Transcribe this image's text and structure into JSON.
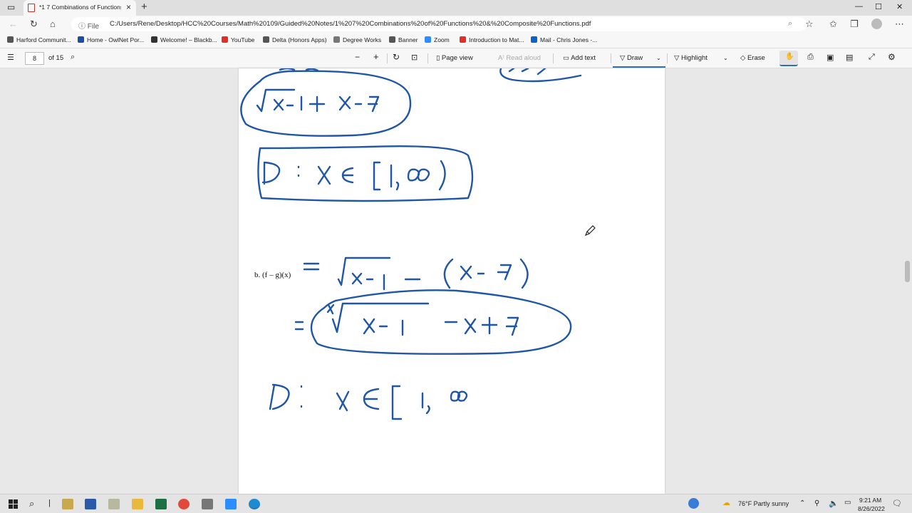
{
  "browser": {
    "tab_title": "*1 7 Combinations of Functions",
    "address_prefix": "File",
    "url": "C:/Users/Rene/Desktop/HCC%20Courses/Math%20109/Guided%20Notes/1%207%20Combinations%20of%20Functions%20&%20Composite%20Functions.pdf",
    "window_controls": {
      "minimize": "—",
      "maximize": "☐",
      "close": "✕"
    }
  },
  "bookmarks": [
    {
      "label": "Harford Communit...",
      "icon": "building-icon",
      "color": "#555555"
    },
    {
      "label": "Home - OwlNet Por...",
      "icon": "owl-icon",
      "color": "#1a4fa0"
    },
    {
      "label": "Welcome! – Blackb...",
      "icon": "blackboard-icon",
      "color": "#333333"
    },
    {
      "label": "YouTube",
      "icon": "youtube-icon",
      "color": "#e52d27"
    },
    {
      "label": "Delta (Honors Apps)",
      "icon": "building-icon",
      "color": "#555555"
    },
    {
      "label": "Degree Works",
      "icon": "document-icon",
      "color": "#777777"
    },
    {
      "label": "Banner",
      "icon": "building-icon",
      "color": "#555555"
    },
    {
      "label": "Zoom",
      "icon": "zoom-icon",
      "color": "#2d8cff"
    },
    {
      "label": "Introduction to Mat...",
      "icon": "youtube-icon",
      "color": "#e52d27"
    },
    {
      "label": "Mail - Chris Jones -...",
      "icon": "outlook-icon",
      "color": "#0a64c2"
    }
  ],
  "pdf_toolbar": {
    "page_current": "8",
    "page_total": "of 15",
    "page_view": "Page view",
    "read_aloud": "Read aloud",
    "add_text": "Add text",
    "draw": "Draw",
    "highlight": "Highlight",
    "erase": "Erase"
  },
  "document": {
    "problem_label": "b.  (f – g)(x)"
  },
  "taskbar": {
    "weather": "76°F  Partly sunny",
    "time": "9:21 AM",
    "date": "8/26/2022"
  },
  "colors": {
    "ink": "#1f56a8",
    "accent": "#2b6fb8"
  }
}
